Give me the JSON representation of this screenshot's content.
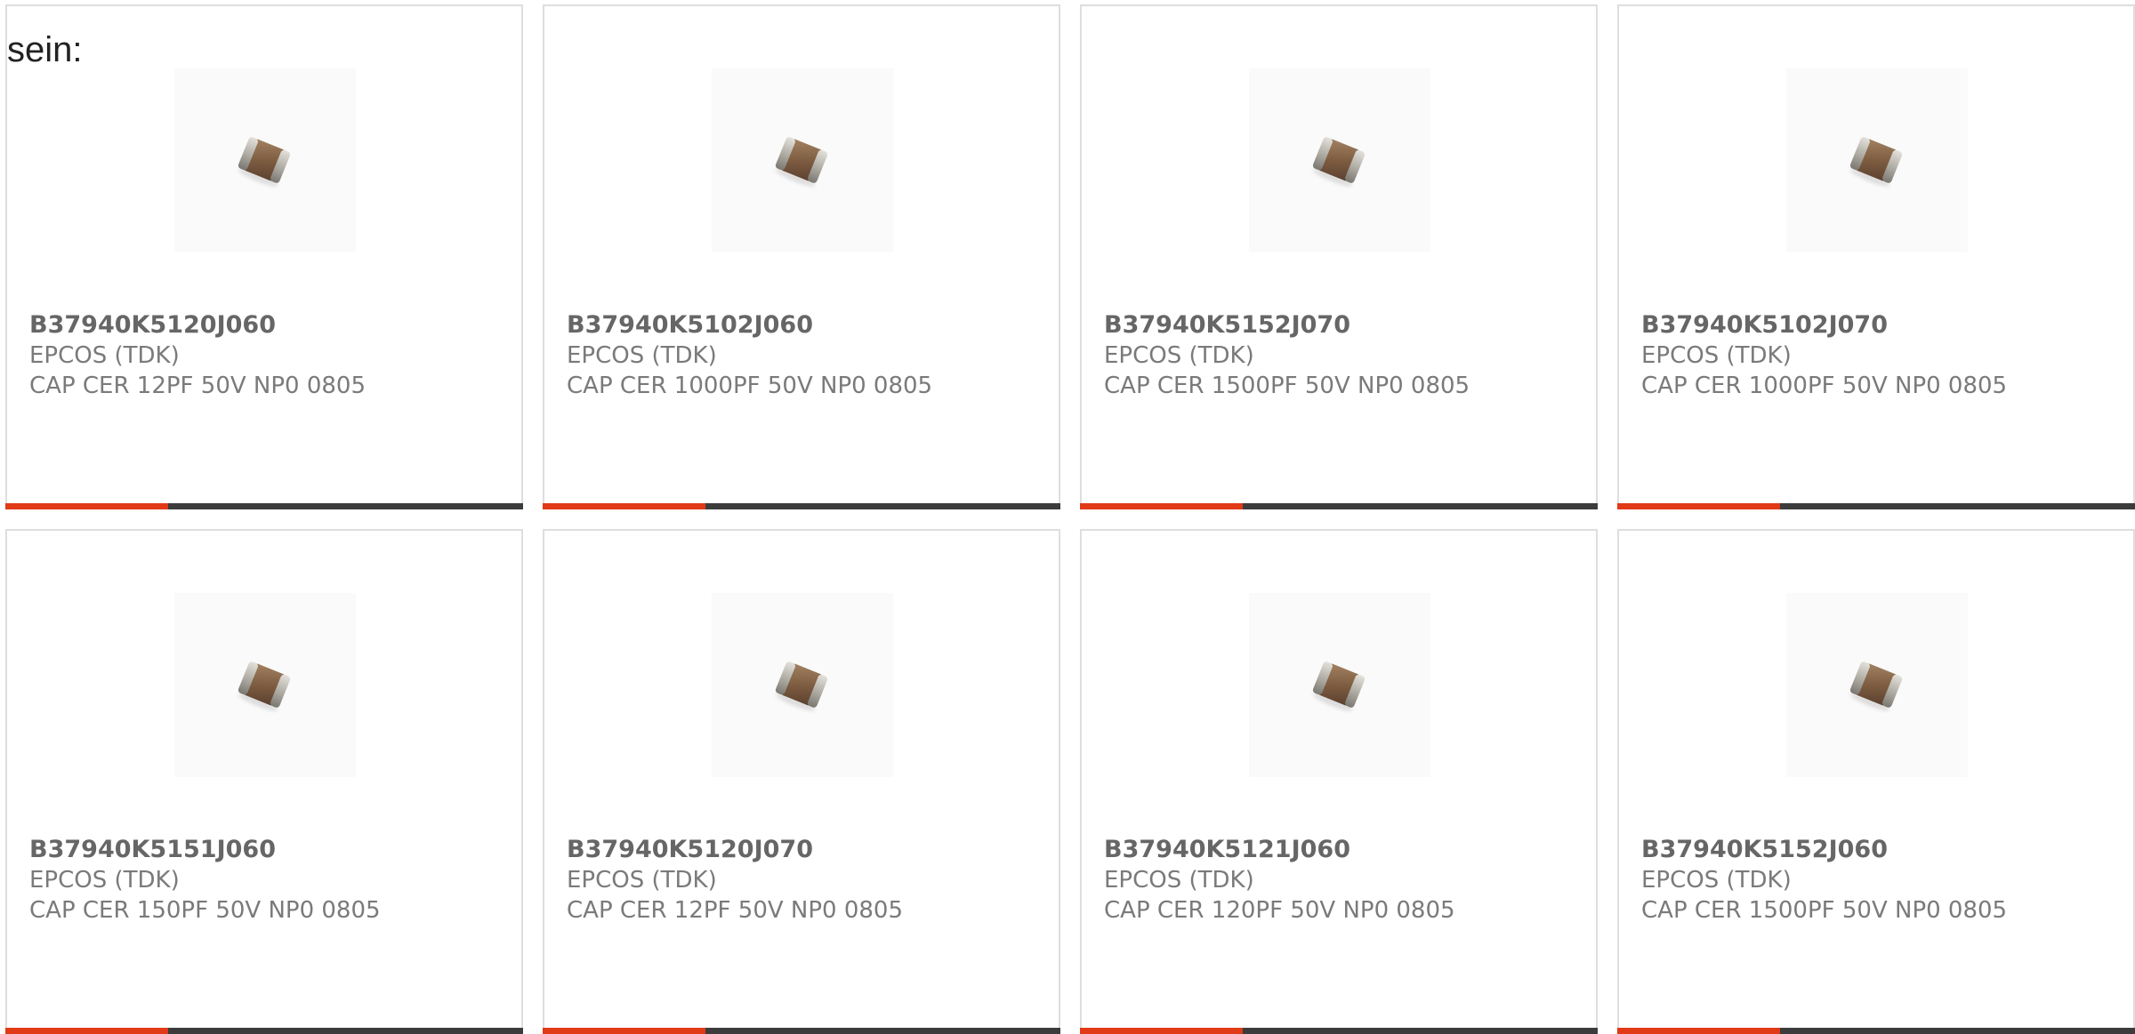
{
  "intro_text": "sein:",
  "colors": {
    "accent": "#e03a17",
    "bar": "#3c3c3c",
    "border": "#dedede"
  },
  "products": [
    {
      "part": "B37940K5120J060",
      "manufacturer": "EPCOS (TDK)",
      "description": "CAP CER 12PF 50V NP0 0805",
      "icon": "ceramic-capacitor-chip"
    },
    {
      "part": "B37940K5102J060",
      "manufacturer": "EPCOS (TDK)",
      "description": "CAP CER 1000PF 50V NP0 0805",
      "icon": "ceramic-capacitor-chip"
    },
    {
      "part": "B37940K5152J070",
      "manufacturer": "EPCOS (TDK)",
      "description": "CAP CER 1500PF 50V NP0 0805",
      "icon": "ceramic-capacitor-chip"
    },
    {
      "part": "B37940K5102J070",
      "manufacturer": "EPCOS (TDK)",
      "description": "CAP CER 1000PF 50V NP0 0805",
      "icon": "ceramic-capacitor-chip"
    },
    {
      "part": "B37940K5151J060",
      "manufacturer": "EPCOS (TDK)",
      "description": "CAP CER 150PF 50V NP0 0805",
      "icon": "ceramic-capacitor-chip"
    },
    {
      "part": "B37940K5120J070",
      "manufacturer": "EPCOS (TDK)",
      "description": "CAP CER 12PF 50V NP0 0805",
      "icon": "ceramic-capacitor-chip"
    },
    {
      "part": "B37940K5121J060",
      "manufacturer": "EPCOS (TDK)",
      "description": "CAP CER 120PF 50V NP0 0805",
      "icon": "ceramic-capacitor-chip"
    },
    {
      "part": "B37940K5152J060",
      "manufacturer": "EPCOS (TDK)",
      "description": "CAP CER 1500PF 50V NP0 0805",
      "icon": "ceramic-capacitor-chip"
    }
  ]
}
